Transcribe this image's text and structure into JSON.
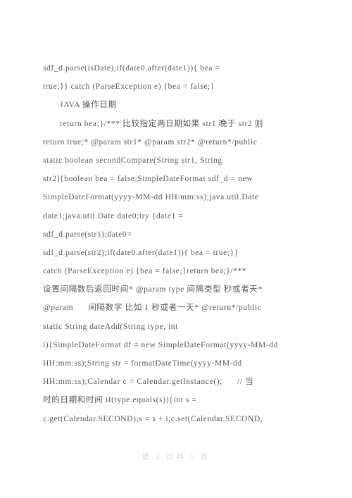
{
  "document": {
    "page_background": "#ffffff",
    "text_color": "#59595b",
    "footer_color": "#d8d8dc",
    "body_lines": [
      {
        "text": "sdf_d.parse(isDate);if(date0.after(date1)){ bea =",
        "indent": 0
      },
      {
        "text": "true;}} catch (ParseException e) {bea = false;}",
        "indent": 0
      },
      {
        "text": "JAVA 操作日期",
        "indent": 1
      },
      {
        "text": "return bea;}/*** 比较指定两日期如果 str1 晚于 str2 则",
        "indent": 1
      },
      {
        "text": "return true;* @param str1* @param str2* @return*/public",
        "indent": 0
      },
      {
        "text": "static boolean secondCompare(String str1, String",
        "indent": 0
      },
      {
        "text": "str2){boolean bea = false;SimpleDateFormat sdf_d = new",
        "indent": 0
      },
      {
        "text": "SimpleDateFormat(yyyy-MM-dd HH:mm:ss);java.util.Date",
        "indent": 0
      },
      {
        "text": "date1;java.util.Date date0;try {date1 =",
        "indent": 0
      },
      {
        "text": "sdf_d.parse(str1);date0=",
        "indent": 0
      },
      {
        "text": "sdf_d.parse(str2);if(date0.after(date1)){ bea = true;}}",
        "indent": 0
      },
      {
        "text": "catch (ParseException e) {bea = false;}return bea;}/***",
        "indent": 0
      },
      {
        "text": "设置间隔数后返回时间* @param type 间隔类型 秒或者天*",
        "indent": 0
      },
      {
        "text": "@param      间隔数字 比如 1 秒或者一天* @return*/public",
        "indent": 0
      },
      {
        "text": "static String dateAdd(String type, int",
        "indent": 0
      },
      {
        "text": "i){SimpleDateFormat df = new SimpleDateFormat(yyyy-MM-dd",
        "indent": 0
      },
      {
        "text": "HH:mm:ss);String str = formatDateTime(yyyy-MM-dd",
        "indent": 0
      },
      {
        "text": "HH:mm:ss);Calendar c = Calendar.getInstance();      // 当",
        "indent": 0
      },
      {
        "text": "时的日期和时间 if(type.equals(s)){int s =",
        "indent": 0
      },
      {
        "text": "c.get(Calendar.SECOND);s = s + i;c.set(Calendar.SECOND,",
        "indent": 0
      }
    ],
    "footer": {
      "text": "第 4 页共 5 页",
      "page_number": 4,
      "total_pages": 5
    }
  }
}
